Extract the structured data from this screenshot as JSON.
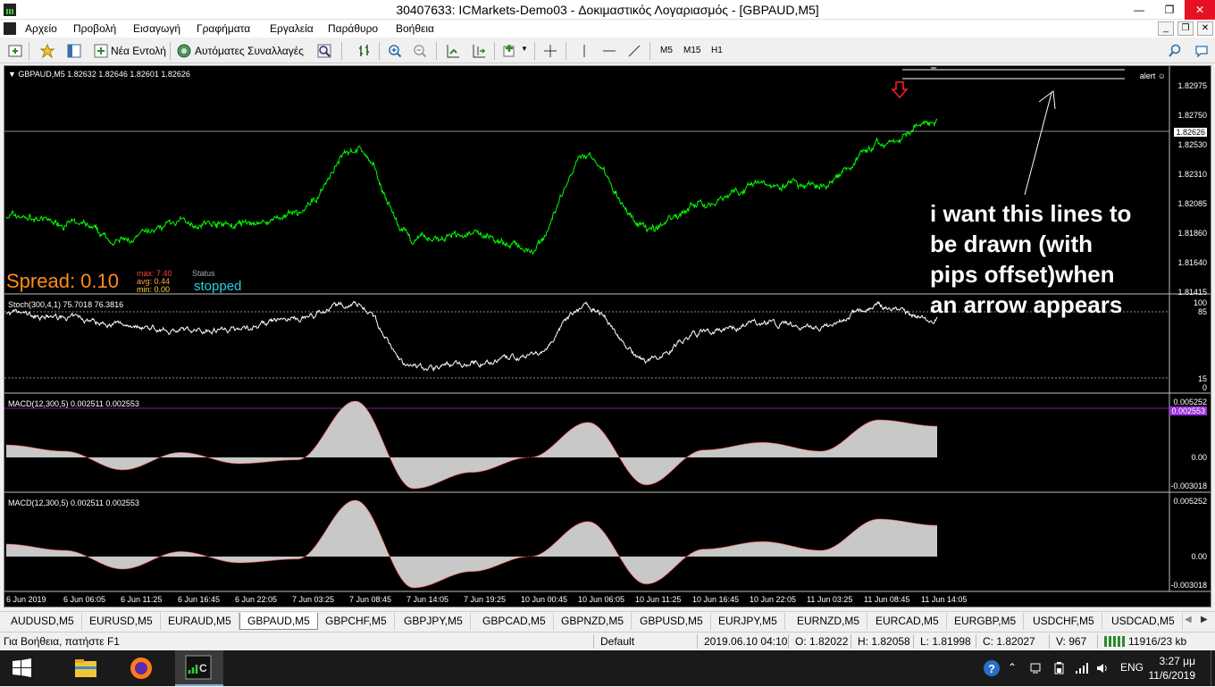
{
  "window": {
    "title": "30407633: ICMarkets-Demo03 - Δοκιμαστικός Λογαριασμός - [GBPAUD,M5]",
    "minimize": "—",
    "restore": "❐",
    "close": "✕"
  },
  "menu": {
    "items": [
      "Αρχείο",
      "Προβολή",
      "Εισαγωγή",
      "Γραφήματα",
      "Εργαλεία",
      "Παράθυρο",
      "Βοήθεια"
    ],
    "mdi": [
      "_",
      "❐",
      "✕"
    ]
  },
  "toolbar": {
    "new_order_label": "Νέα Εντολή",
    "auto_trading_label": "Αυτόματες Συναλλαγές",
    "timeframes": [
      "M5",
      "M15",
      "H1"
    ]
  },
  "chart": {
    "symbol_header": "GBPAUD,M5  1.82632 1.82646 1.82601 1.82626",
    "alert_label": "alert",
    "current_price": "1.82626",
    "price_ticks": [
      "1.82975",
      "1.82750",
      "1.82530",
      "1.82310",
      "1.82085",
      "1.81860",
      "1.81640",
      "1.81415"
    ],
    "spread_label": "Spread: 0.10",
    "spread_stats": {
      "max": "max: 7.40",
      "avg": "avg: 0.44",
      "min": "min: 0.00"
    },
    "status_label": "Status",
    "status_value": "stopped",
    "annotation": [
      "i want this lines to",
      "be drawn (with",
      "pips offset)when",
      "an arrow appears"
    ],
    "colors": {
      "price": "#00ff00",
      "spread": "#ff8c1a",
      "status": "#22d0e8",
      "arrow": "#ff2020",
      "max": "#ff4040",
      "avg": "#ffa040",
      "min": "#ffd040"
    }
  },
  "stoch": {
    "header": "Stoch(300,4,1) 75.7018 76.3816",
    "ticks": [
      "100",
      "85",
      "15",
      "0"
    ]
  },
  "macd1": {
    "header": "MACD(12,300,5) 0.002511 0.002553",
    "ticks": [
      "0.005252",
      "0.00",
      "-0.003018"
    ],
    "highlight": "0.002553"
  },
  "macd2": {
    "header": "MACD(12,300,5) 0.002511 0.002553",
    "ticks": [
      "0.005252",
      "0.00",
      "-0.003018"
    ]
  },
  "dates": [
    "6 Jun 2019",
    "6 Jun 06:05",
    "6 Jun 11:25",
    "6 Jun 16:45",
    "6 Jun 22:05",
    "7 Jun 03:25",
    "7 Jun 08:45",
    "7 Jun 14:05",
    "7 Jun 19:25",
    "10 Jun 00:45",
    "10 Jun 06:05",
    "10 Jun 11:25",
    "10 Jun 16:45",
    "10 Jun 22:05",
    "11 Jun 03:25",
    "11 Jun 08:45",
    "11 Jun 14:05"
  ],
  "tabs": [
    "AUDUSD,M5",
    "EURUSD,M5",
    "EURAUD,M5",
    "GBPAUD,M5",
    "GBPCHF,M5",
    "GBPJPY,M5",
    "GBPCAD,M5",
    "GBPNZD,M5",
    "GBPUSD,M5",
    "EURJPY,M5",
    "EURNZD,M5",
    "EURCAD,M5",
    "EURGBP,M5",
    "USDCHF,M5",
    "USDCAD,M5"
  ],
  "active_tab": "GBPAUD,M5",
  "status": {
    "help": "Για Βοήθεια, πατήστε F1",
    "profile": "Default",
    "datetime": "2019.06.10 04:10",
    "open": "O: 1.82022",
    "high": "H: 1.82058",
    "low": "L: 1.81998",
    "close": "C: 1.82027",
    "volume": "V: 967",
    "traffic": "11916/23 kb"
  },
  "taskbar": {
    "lang": "ENG",
    "time": "3:27 μμ",
    "date": "11/6/2019"
  },
  "chart_data": {
    "type": "line",
    "x": [
      "6 Jun 2019",
      "6 Jun 06:05",
      "6 Jun 11:25",
      "6 Jun 16:45",
      "6 Jun 22:05",
      "7 Jun 03:25",
      "7 Jun 08:45",
      "7 Jun 14:05",
      "7 Jun 19:25",
      "10 Jun 00:45",
      "10 Jun 06:05",
      "10 Jun 11:25",
      "10 Jun 16:45",
      "10 Jun 22:05",
      "11 Jun 03:25",
      "11 Jun 08:45",
      "11 Jun 14:05"
    ],
    "ylim": [
      1.81415,
      1.831
    ],
    "grid": false,
    "series": [
      {
        "values": [
          1.82,
          1.8195,
          1.818,
          1.8195,
          1.8192,
          1.82,
          1.8252,
          1.818,
          1.8185,
          1.8175,
          1.8245,
          1.819,
          1.821,
          1.8225,
          1.8222,
          1.8255,
          1.8275
        ]
      },
      {
        "values": [
          84,
          78,
          70,
          62,
          65,
          78,
          96,
          15,
          22,
          30,
          92,
          25,
          60,
          72,
          66,
          92,
          76
        ]
      },
      {
        "values": [
          0.001,
          0.0005,
          -0.001,
          0.0004,
          -0.0005,
          -0.0002,
          0.0045,
          -0.0025,
          -0.0012,
          0.0,
          0.0028,
          -0.0022,
          0.0006,
          0.0012,
          0.0005,
          0.003,
          0.0025
        ]
      }
    ]
  }
}
